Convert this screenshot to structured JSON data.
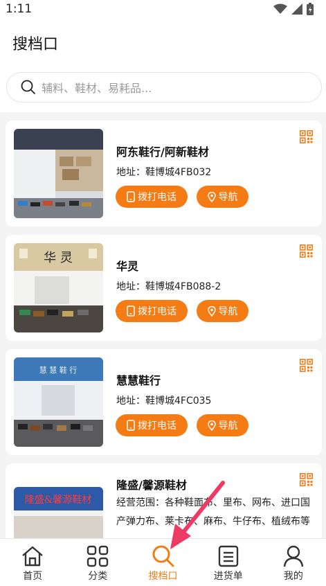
{
  "status": {
    "time": "1:11"
  },
  "page": {
    "title": "搜档口"
  },
  "search": {
    "placeholder": "辅料、鞋材、易耗品..."
  },
  "stores": [
    {
      "name": "阿东鞋行/阿新鞋材",
      "address": "地址：鞋博城4FB032",
      "call_label": "拨打电话",
      "nav_label": "导航"
    },
    {
      "name": "华灵",
      "address": "地址：鞋博城4FB088-2",
      "call_label": "拨打电话",
      "nav_label": "导航"
    },
    {
      "name": "慧慧鞋行",
      "address": "地址：鞋博城4FC035",
      "call_label": "拨打电话",
      "nav_label": "导航"
    },
    {
      "name": "隆盛/馨源鞋材",
      "scope": "经营范围：各种鞋面布、里布、网布、进口国产弹力布、莱卡布、麻布、牛仔布、植绒布等"
    }
  ],
  "tabbar": {
    "items": [
      {
        "label": "首页",
        "icon": "home-icon"
      },
      {
        "label": "分类",
        "icon": "grid-icon"
      },
      {
        "label": "搜档口",
        "icon": "search-icon",
        "active": true
      },
      {
        "label": "进货单",
        "icon": "list-icon"
      },
      {
        "label": "我的",
        "icon": "user-icon"
      }
    ]
  },
  "colors": {
    "accent": "#f57c14",
    "annotation_arrow": "#ee3b63"
  }
}
